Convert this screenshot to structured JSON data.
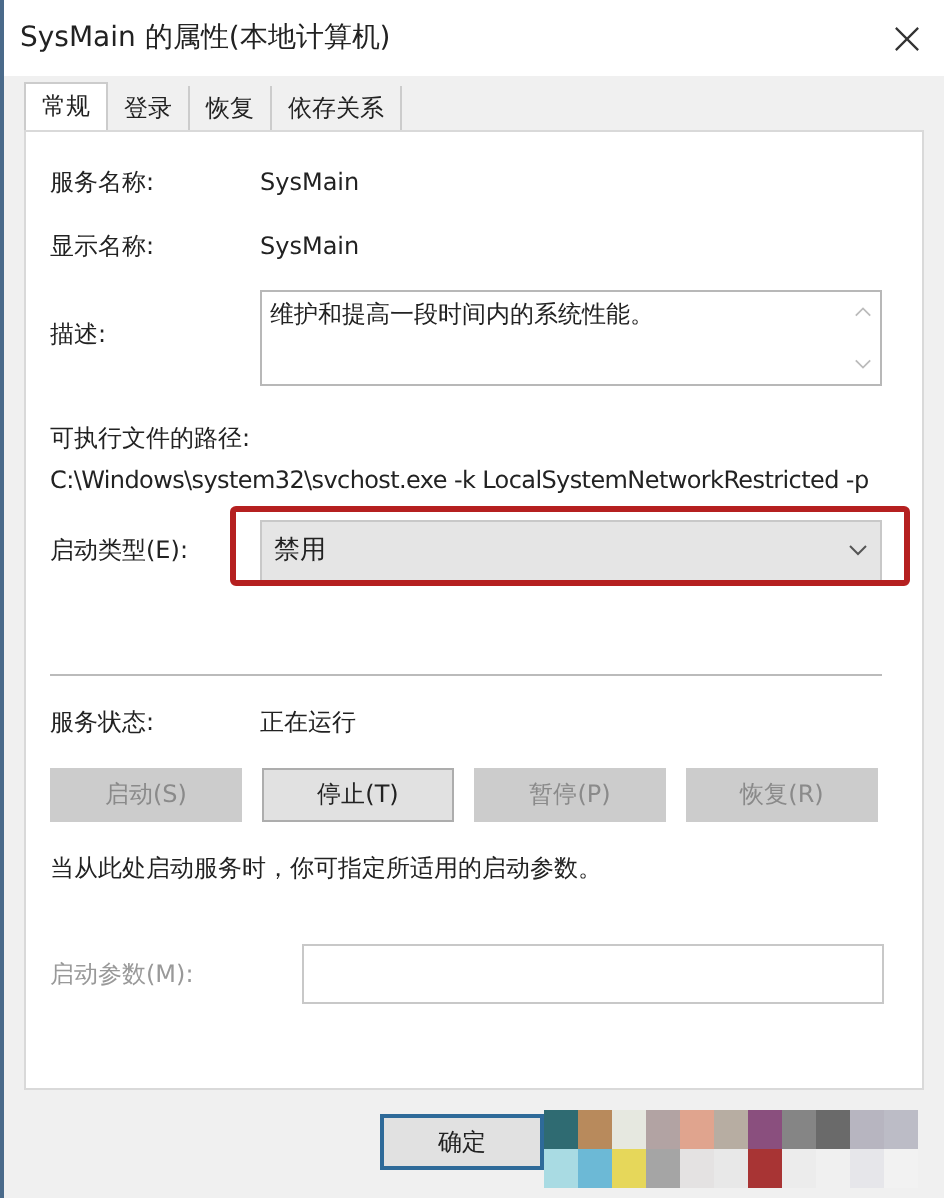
{
  "window": {
    "title": "SysMain 的属性(本地计算机)"
  },
  "tabs": [
    {
      "label": "常规",
      "selected": true
    },
    {
      "label": "登录",
      "selected": false
    },
    {
      "label": "恢复",
      "selected": false
    },
    {
      "label": "依存关系",
      "selected": false
    }
  ],
  "service_name": {
    "label": "服务名称:",
    "value": "SysMain"
  },
  "display_name": {
    "label": "显示名称:",
    "value": "SysMain"
  },
  "description": {
    "label": "描述:",
    "value": "维护和提高一段时间内的系统性能。"
  },
  "executable_path": {
    "label": "可执行文件的路径:",
    "value": "C:\\Windows\\system32\\svchost.exe -k LocalSystemNetworkRestricted -p"
  },
  "startup_type": {
    "label": "启动类型(E):",
    "value": "禁用",
    "highlighted": true
  },
  "service_status": {
    "label": "服务状态:",
    "value": "正在运行"
  },
  "service_buttons": [
    {
      "label": "启动(S)",
      "disabled": true
    },
    {
      "label": "停止(T)",
      "disabled": false
    },
    {
      "label": "暂停(P)",
      "disabled": true
    },
    {
      "label": "恢复(R)",
      "disabled": true
    }
  ],
  "hint": "当从此处启动服务时，你可指定所适用的启动参数。",
  "start_parameters": {
    "label": "启动参数(M):",
    "disabled": true
  },
  "dialog_buttons": [
    "确定"
  ]
}
